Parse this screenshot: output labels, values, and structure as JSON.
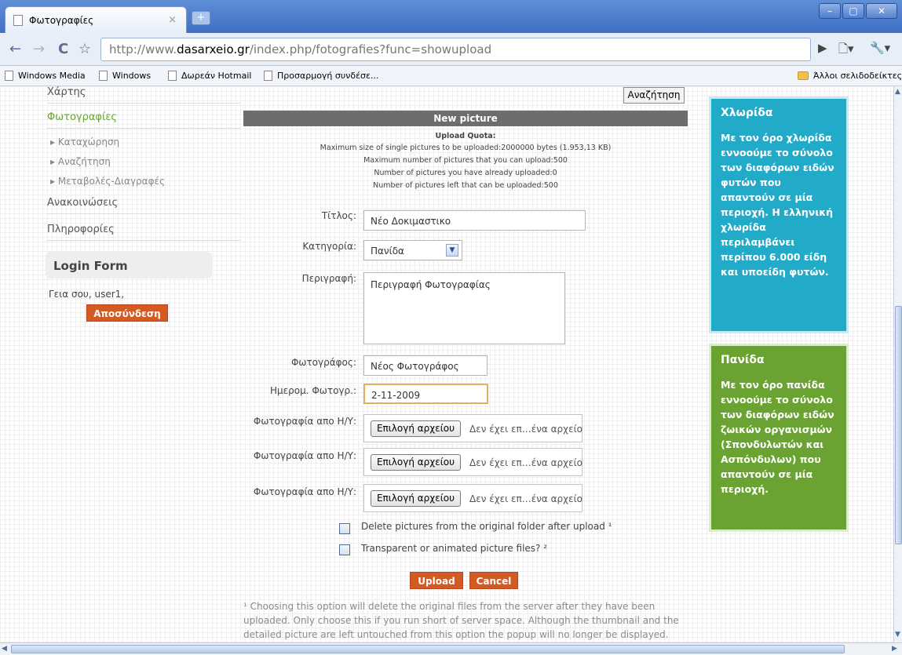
{
  "browser": {
    "tab_title": "Φωτογραφίες",
    "tab_close": "×",
    "new_tab": "+",
    "window_buttons": [
      "–",
      "▢",
      "✕"
    ],
    "url_prefix": "http://www.",
    "url_host": "dasarxeio.gr",
    "url_path": "/index.php/fotografies?func=showupload",
    "bookmarks": [
      "Windows Media",
      "Windows",
      "Δωρεάν Hotmail",
      "Προσαρμογή συνδέσε..."
    ],
    "other_bookmarks": "Άλλοι σελιδοδείκτες"
  },
  "sidebar": {
    "items": [
      {
        "label": "Χάρτης"
      },
      {
        "label": "Φωτογραφίες"
      },
      {
        "label": "Ανακοινώσεις"
      },
      {
        "label": "Πληροφορίες"
      }
    ],
    "sub_items": [
      "▸ Καταχώρηση",
      "▸ Αναζήτηση",
      "▸ Μεταβολές-Διαγραφές"
    ],
    "login_title": "Login Form",
    "greeting": "Γεια σου, user1,",
    "logout": "Αποσύνδεση"
  },
  "form": {
    "search_button": "Αναζήτηση",
    "header": "New picture",
    "quota_title": "Upload Quota:",
    "quota_lines": [
      "Maximum size of single pictures to be uploaded:2000000 bytes (1.953,13 KB)",
      "Maximum number of pictures that you can upload:500",
      "Number of pictures you have already uploaded:0",
      "Number of pictures left that can be uploaded:500"
    ],
    "title_label": "Τίτλος:",
    "title_value": "Νέο Δοκιμαστικο",
    "category_label": "Κατηγορία:",
    "category_value": "Πανίδα",
    "description_label": "Περιγραφή:",
    "description_value": "Περιγραφή Φωτογραφίας",
    "photographer_label": "Φωτογράφος:",
    "photographer_value": "Νέος Φωτογράφος",
    "date_label": "Ημερομ. Φωτογρ.:",
    "date_value": "2-11-2009",
    "file_label": "Φωτογραφία απο Η/Υ:",
    "file_button": "Επιλογή αρχείου",
    "file_status": "Δεν έχει επ…ένα αρχείο",
    "checkbox_delete": "Delete pictures from the original folder after upload ¹",
    "checkbox_transparent": "Transparent or animated picture files? ²",
    "upload_button": "Upload",
    "cancel_button": "Cancel",
    "footnote": "¹ Choosing this option will delete the original files from the server after they have been uploaded. Only choose this if you run short of server space. Although the thumbnail and the detailed picture are left untouched from this option the popup will no longer be displayed."
  },
  "right_boxes": {
    "flora_title": "Χλωρίδα",
    "flora_text": "Με τον όρο χλωρίδα εννοούμε το σύνολο των διαφόρων ειδών φυτών που απαντούν σε μία περιοχή. Η ελληνική χλωρίδα περιλαμβάνει περίπου 6.000 είδη και υποείδη φυτών.",
    "fauna_title": "Πανίδα",
    "fauna_text": "Με τον όρο πανίδα εννοούμε το σύνολο των διαφόρων ειδών ζωικών οργανισμών (Σπονδυλωτών και Ασπόνδυλων) που απαντούν σε μία περιοχή."
  },
  "colors": {
    "accent_orange": "#d35a22",
    "active_green": "#6aa52f",
    "flora_blue": "#22aac9",
    "fauna_green": "#6aa332"
  }
}
